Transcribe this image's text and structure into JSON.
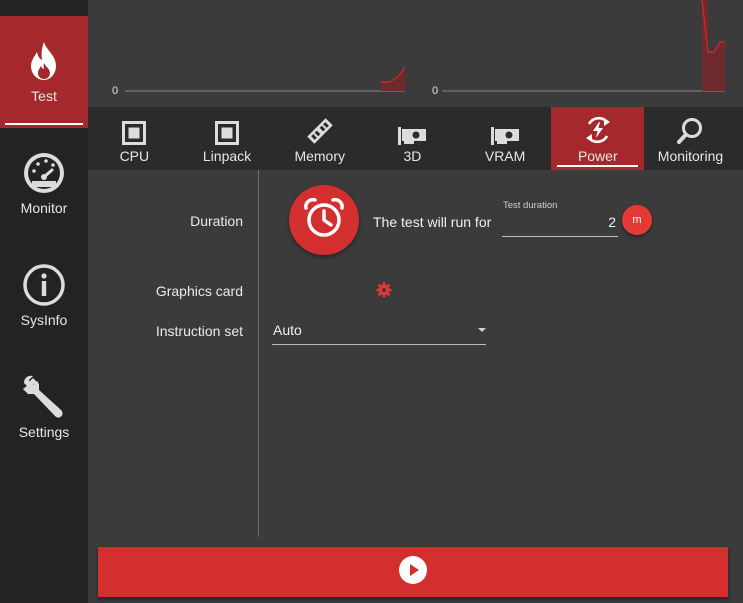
{
  "colors": {
    "accent": "#d32f2f",
    "active_bg": "#a5282c",
    "sidebar_bg": "#232323",
    "panel_bg": "#3b3b3b",
    "tabs_bg": "#2b2b2b"
  },
  "sidebar": {
    "items": [
      {
        "label": "Test",
        "icon": "flame-icon",
        "active": true
      },
      {
        "label": "Monitor",
        "icon": "gauge-icon",
        "active": false
      },
      {
        "label": "SysInfo",
        "icon": "info-icon",
        "active": false
      },
      {
        "label": "Settings",
        "icon": "wrench-icon",
        "active": false
      }
    ]
  },
  "graphs": {
    "left_min": "0",
    "right_min": "0"
  },
  "tabs": [
    {
      "label": "CPU",
      "icon": "cpu-icon"
    },
    {
      "label": "Linpack",
      "icon": "cpu-icon"
    },
    {
      "label": "Memory",
      "icon": "memory-icon"
    },
    {
      "label": "3D",
      "icon": "graphics-card-icon"
    },
    {
      "label": "VRAM",
      "icon": "graphics-card-icon"
    },
    {
      "label": "Power",
      "icon": "power-icon",
      "active": true
    },
    {
      "label": "Monitoring",
      "icon": "magnifier-icon"
    }
  ],
  "settings": {
    "duration_label": "Duration",
    "will_run_text": "The test will run for",
    "duration_caption": "Test duration",
    "duration_value": "2",
    "duration_unit": "m",
    "graphics_card_label": "Graphics card",
    "instruction_set_label": "Instruction set",
    "instruction_set_value": "Auto"
  }
}
